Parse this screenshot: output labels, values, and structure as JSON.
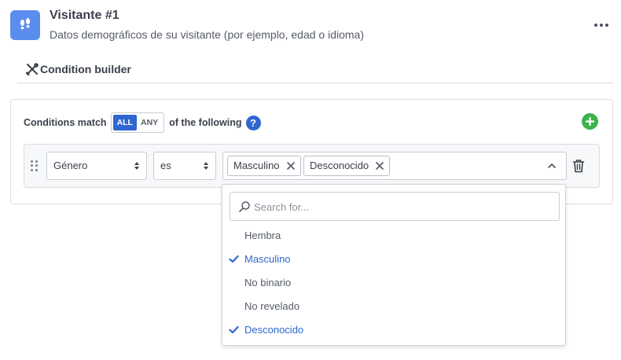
{
  "header": {
    "icon": "footprints-icon",
    "title": "Visitante #1",
    "subtitle": "Datos demográficos de su visitante (por ejemplo, edad o idioma)",
    "more_icon": "more-horizontal-icon"
  },
  "tabs": [
    {
      "label": "Condition builder",
      "icon": "tools-icon"
    }
  ],
  "builder": {
    "match_prefix": "Conditions match",
    "match_all": "ALL",
    "match_any": "ANY",
    "match_selected": "ALL",
    "match_suffix": "of the following",
    "help_glyph": "?",
    "accent_color": "#2f66d0",
    "add_color": "#3fb24d"
  },
  "condition": {
    "field": "Género",
    "operator": "es",
    "values": [
      "Masculino",
      "Desconocido"
    ]
  },
  "dropdown": {
    "search_placeholder": "Search for...",
    "options": [
      {
        "label": "Hembra",
        "selected": false
      },
      {
        "label": "Masculino",
        "selected": true
      },
      {
        "label": "No binario",
        "selected": false
      },
      {
        "label": "No revelado",
        "selected": false
      },
      {
        "label": "Desconocido",
        "selected": true
      }
    ]
  }
}
